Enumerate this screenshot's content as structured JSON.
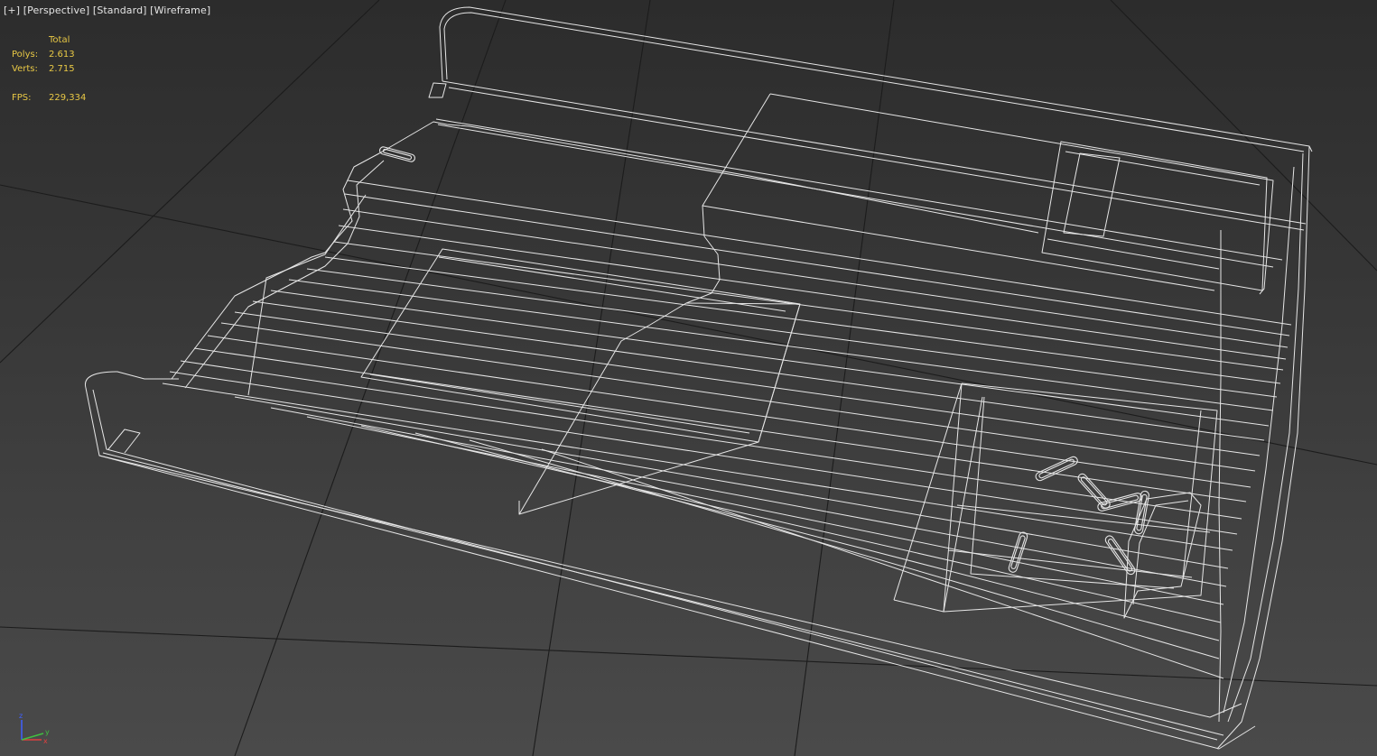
{
  "viewport": {
    "labels": [
      "[+]",
      "[Perspective]",
      "[Standard]",
      "[Wireframe]"
    ],
    "background_color": "#3a3a3a",
    "grid_color": "#1c1c1c",
    "wire_color": "#e6e6e6"
  },
  "statistics": {
    "header": "Total",
    "polys_label": "Polys:",
    "polys_value": "2.613",
    "verts_label": "Verts:",
    "verts_value": "2.715",
    "fps_label": "FPS:",
    "fps_value": "229,334",
    "text_color": "#e8c845"
  },
  "axis_gizmo": {
    "z": "z",
    "x": "x",
    "y": "y",
    "z_color": "#4060ff",
    "x_color": "#e04040",
    "y_color": "#40c040"
  }
}
